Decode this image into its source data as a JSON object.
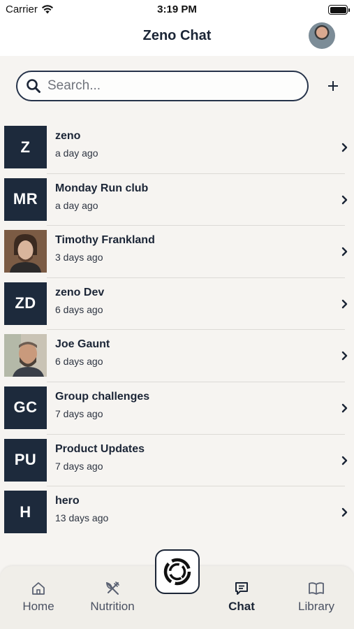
{
  "status_bar": {
    "carrier": "Carrier",
    "time": "3:19 PM"
  },
  "header": {
    "title": "Zeno Chat"
  },
  "search": {
    "placeholder": "Search..."
  },
  "conversations": [
    {
      "initials": "Z",
      "name": "zeno",
      "time": "a day ago",
      "avatar": "initials"
    },
    {
      "initials": "MR",
      "name": "Monday Run club",
      "time": "a day ago",
      "avatar": "initials"
    },
    {
      "initials": "",
      "name": "Timothy Frankland",
      "time": "3 days ago",
      "avatar": "photo"
    },
    {
      "initials": "ZD",
      "name": "zeno Dev",
      "time": "6 days ago",
      "avatar": "initials"
    },
    {
      "initials": "",
      "name": "Joe Gaunt",
      "time": "6 days ago",
      "avatar": "photo"
    },
    {
      "initials": "GC",
      "name": "Group challenges",
      "time": "7 days ago",
      "avatar": "initials"
    },
    {
      "initials": "PU",
      "name": "Product Updates",
      "time": "7 days ago",
      "avatar": "initials"
    },
    {
      "initials": "H",
      "name": "hero",
      "time": "13 days ago",
      "avatar": "initials"
    }
  ],
  "tabs": [
    {
      "label": "Home",
      "icon": "home-icon",
      "active": false
    },
    {
      "label": "Nutrition",
      "icon": "utensils-icon",
      "active": false
    },
    {
      "label": "Chat",
      "icon": "chat-icon",
      "active": true
    },
    {
      "label": "Library",
      "icon": "book-icon",
      "active": false
    }
  ],
  "colors": {
    "navy": "#1d2a3c",
    "background": "#f6f4f1",
    "tab_bar": "#f0eee9"
  }
}
